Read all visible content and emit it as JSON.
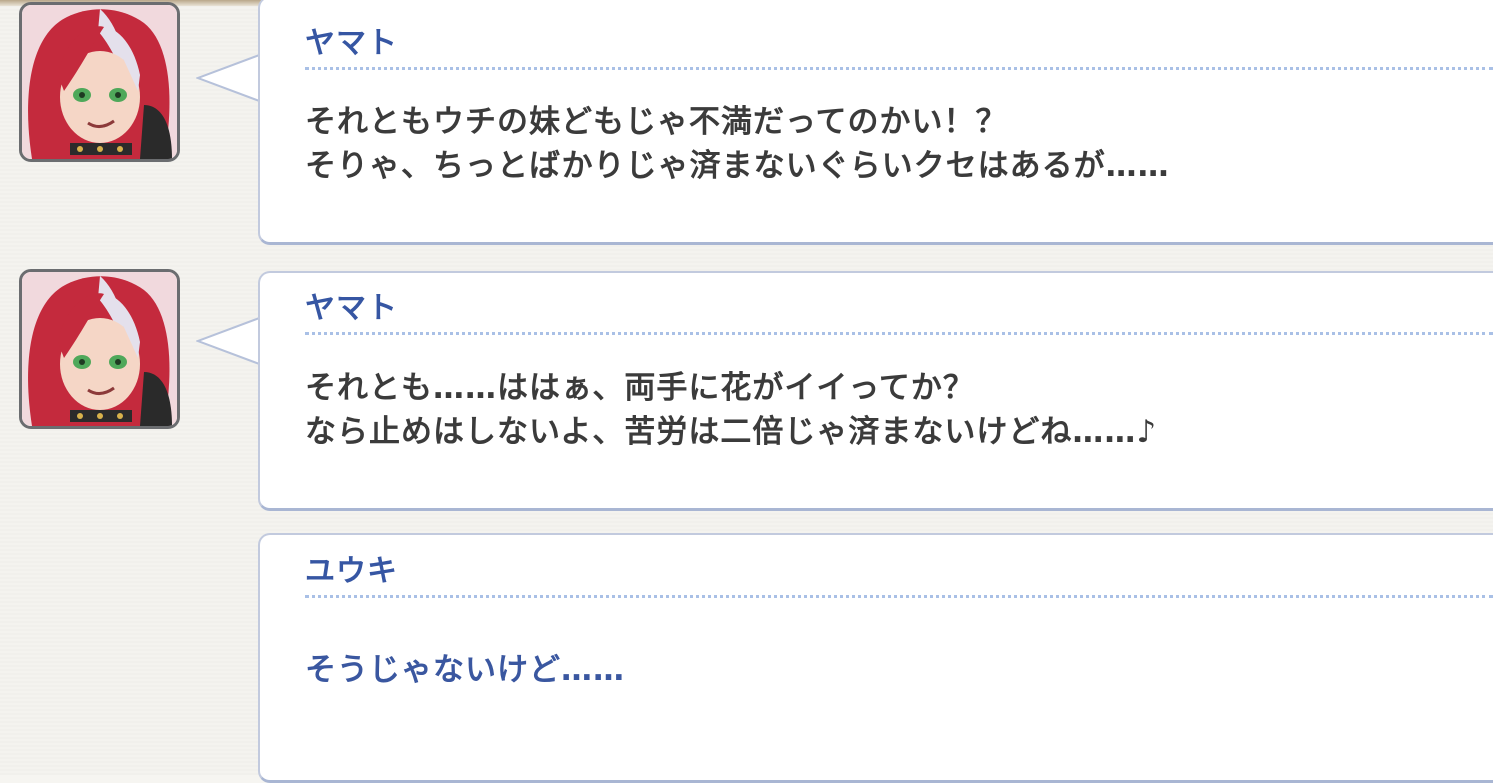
{
  "log": [
    {
      "speaker": "ヤマト",
      "has_avatar": true,
      "lines": [
        "それともウチの妹どもじゃ不満だってのかい！？",
        "そりゃ、ちっとばかりじゃ済まないぐらいクセはあるが……"
      ]
    },
    {
      "speaker": "ヤマト",
      "has_avatar": true,
      "lines": [
        "それとも……ははぁ、両手に花がイイってか？",
        "なら止めはしないよ、苦労は二倍じゃ済まないけどね……♪"
      ]
    },
    {
      "speaker": "ユウキ",
      "has_avatar": false,
      "lines": [
        "そうじゃないけど……"
      ]
    }
  ],
  "colors": {
    "speaker_name": "#3656a3",
    "npc_text": "#3b3b3b",
    "player_text": "#3a57a0",
    "bubble_border": "#a9b6d3",
    "divider": "#a9c0e6"
  },
  "icons": {
    "avatar": "yamato-portrait-icon"
  }
}
